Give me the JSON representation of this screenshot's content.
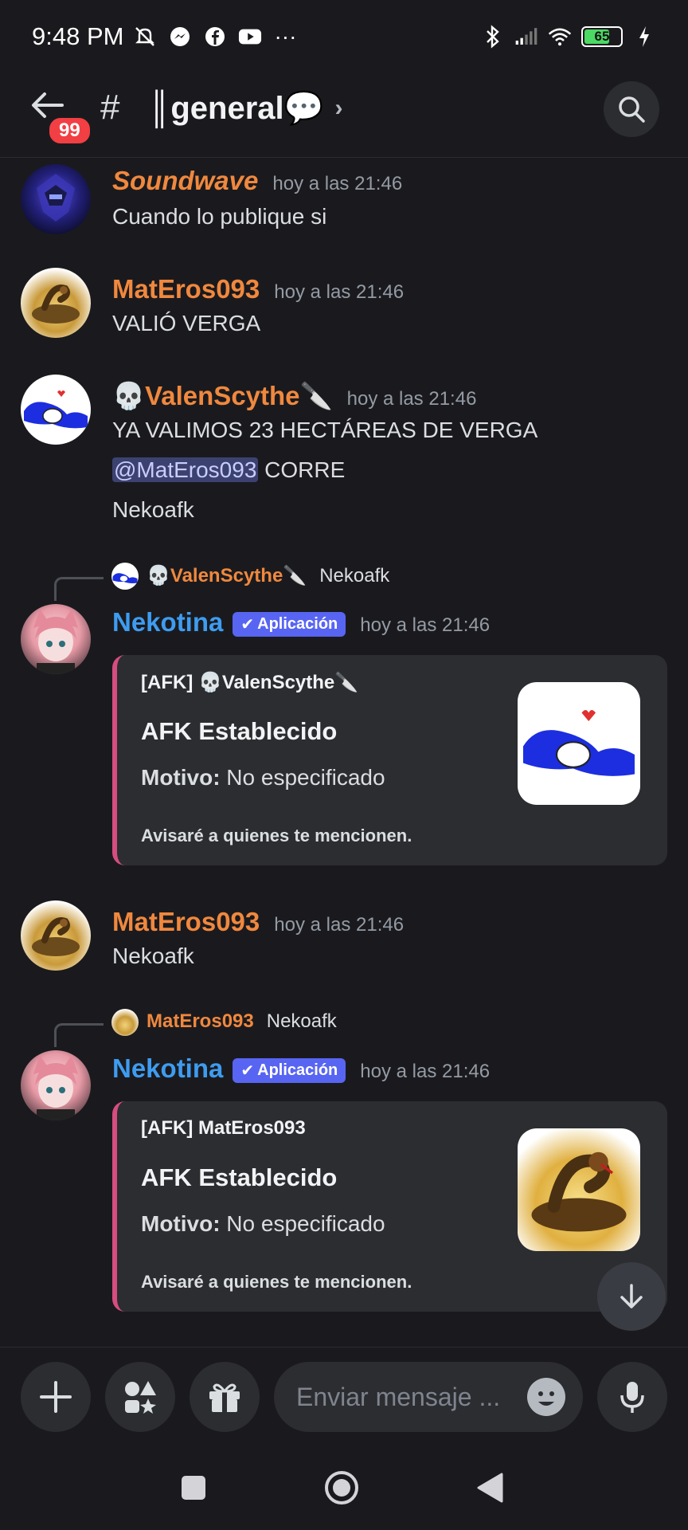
{
  "status_bar": {
    "time": "9:48 PM",
    "battery_level": "65",
    "icons": [
      "mute-bell-icon",
      "messenger-icon",
      "facebook-icon",
      "youtube-icon",
      "more-dots-icon",
      "bluetooth-icon",
      "signal-icon",
      "wifi-icon",
      "battery-icon",
      "charging-icon"
    ]
  },
  "header": {
    "unread_badge": "99",
    "hash": "#",
    "channel_name": "║general💬",
    "chevron": "›"
  },
  "messages": [
    {
      "author": "Soundwave",
      "timestamp": "hoy a las 21:46",
      "lines": [
        "Cuando lo publique si"
      ]
    },
    {
      "author": "MatEros093",
      "timestamp": "hoy a las 21:46",
      "lines": [
        "VALIÓ VERGA"
      ]
    },
    {
      "author": "💀ValenScythe🔪",
      "timestamp": "hoy a las 21:46",
      "line1": "YA VALIMOS 23 HECTÁREAS DE VERGA",
      "mention": "@MatEros093",
      "line2_rest": " CORRE",
      "line3": "Nekoafk"
    },
    {
      "reply_to": "💀ValenScythe🔪",
      "reply_text": "Nekoafk",
      "author": "Nekotina",
      "app_tag": "Aplicación",
      "timestamp": "hoy a las 21:46",
      "embed": {
        "author": "[AFK] 💀ValenScythe🔪",
        "title": "AFK Establecido",
        "field_name": "Motivo:",
        "field_value": " No especificado",
        "footer": "Avisaré a quienes te mencionen."
      }
    },
    {
      "author": "MatEros093",
      "timestamp": "hoy a las 21:46",
      "lines": [
        "Nekoafk"
      ]
    },
    {
      "reply_to": "MatEros093",
      "reply_text": "Nekoafk",
      "author": "Nekotina",
      "app_tag": "Aplicación",
      "timestamp": "hoy a las 21:46",
      "embed": {
        "author": "[AFK] MatEros093",
        "title": "AFK Establecido",
        "field_name": "Motivo:",
        "field_value": " No especificado",
        "footer": "Avisaré a quienes te mencionen."
      }
    }
  ],
  "composer": {
    "placeholder": "Enviar mensaje ..."
  },
  "colors": {
    "background": "#1a1a1e",
    "username_orange": "#f0883e",
    "bot_blue": "#3e9cf0",
    "app_tag": "#5865f2",
    "embed_border": "#d64d7f",
    "badge_red": "#f23f43"
  }
}
